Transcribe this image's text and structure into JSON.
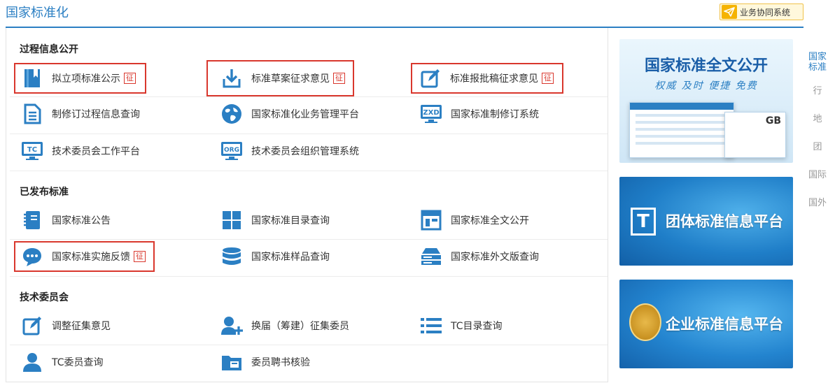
{
  "header": {
    "title": "国家标准化",
    "collab_button": "业务协同系统"
  },
  "sections": [
    {
      "title": "过程信息公开",
      "rows": [
        [
          {
            "label": "拟立项标准公示",
            "badge": "征",
            "icon": "bookmark-book-icon"
          },
          {
            "label": "标准草案征求意见",
            "badge": "征",
            "icon": "download-tray-icon"
          },
          {
            "label": "标准报批稿征求意见",
            "badge": "征",
            "icon": "edit-pencil-icon"
          }
        ],
        [
          {
            "label": "制修订过程信息查询",
            "icon": "document-list-icon"
          },
          {
            "label": "国家标准化业务管理平台",
            "icon": "globe-icon"
          },
          {
            "label": "国家标准制修订系统",
            "icon": "monitor-zxd-icon"
          }
        ],
        [
          {
            "label": "技术委员会工作平台",
            "icon": "monitor-tc-icon"
          },
          {
            "label": "技术委员会组织管理系统",
            "icon": "monitor-org-icon"
          }
        ]
      ]
    },
    {
      "title": "已发布标准",
      "rows": [
        [
          {
            "label": "国家标准公告",
            "icon": "notebook-icon"
          },
          {
            "label": "国家标准目录查询",
            "icon": "grid-icon"
          },
          {
            "label": "国家标准全文公开",
            "icon": "layout-window-icon"
          }
        ],
        [
          {
            "label": "国家标准实施反馈",
            "badge": "征",
            "icon": "chat-bubble-icon"
          },
          {
            "label": "国家标准样品查询",
            "icon": "database-icon"
          },
          {
            "label": "国家标准外文版查询",
            "icon": "server-stack-icon"
          }
        ]
      ]
    },
    {
      "title": "技术委员会",
      "rows": [
        [
          {
            "label": "调整征集意见",
            "icon": "edit-pencil-icon"
          },
          {
            "label": "换届（筹建）征集委员",
            "icon": "add-user-icon"
          },
          {
            "label": "TC目录查询",
            "icon": "list-icon"
          }
        ],
        [
          {
            "label": "TC委员查询",
            "icon": "user-icon"
          },
          {
            "label": "委员聘书核验",
            "icon": "folder-icon"
          }
        ]
      ]
    }
  ],
  "banners": [
    {
      "title": "国家标准全文公开",
      "subtitle": "权威 及时 便捷 免费",
      "doc_mark": "GB"
    },
    {
      "title": "团体标准信息平台",
      "logo_glyph": "T"
    },
    {
      "title": "企业标准信息平台"
    }
  ],
  "side_tabs": [
    {
      "label": "国家标准",
      "active": true
    },
    {
      "label": "行",
      "active": false
    },
    {
      "label": "地",
      "active": false
    },
    {
      "label": "团",
      "active": false
    },
    {
      "label": "国际",
      "active": false
    },
    {
      "label": "国外",
      "active": false
    }
  ],
  "colors": {
    "accent": "#2b7fc3",
    "badge": "#d9372d",
    "icon": "#2b7fc3",
    "collab_icon": "#f5b301"
  }
}
